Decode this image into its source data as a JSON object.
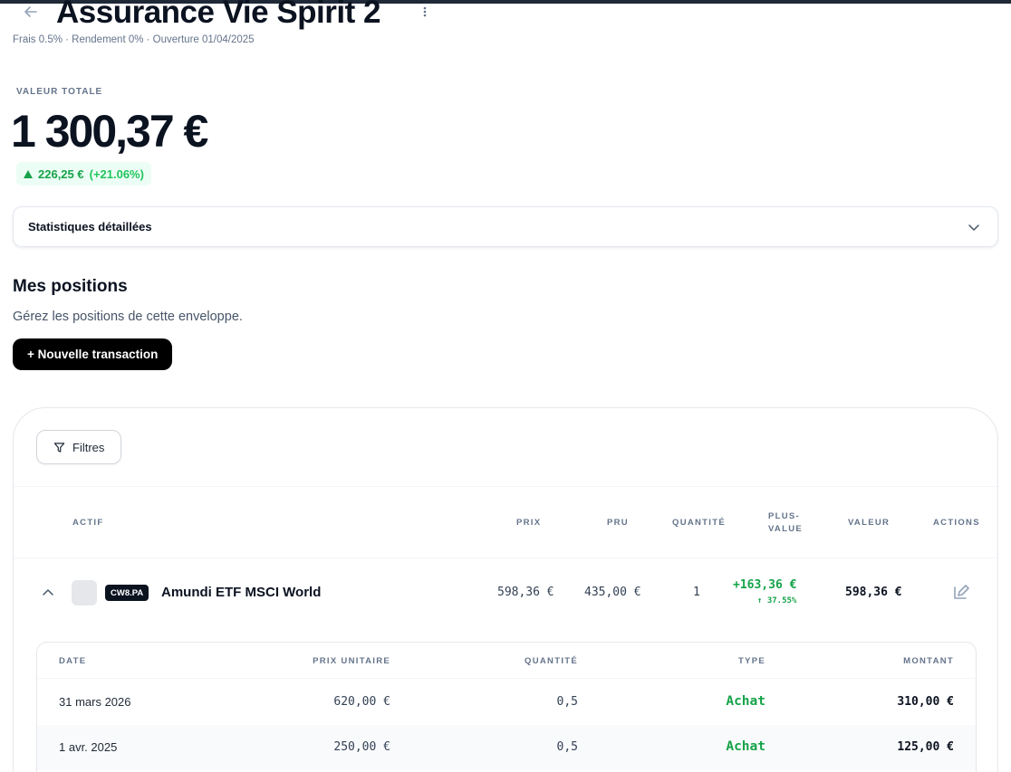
{
  "header": {
    "title": "Assurance Vie Spirit 2",
    "subtitle": "Frais 0.5% · Rendement 0% · Ouverture 01/04/2025"
  },
  "summary": {
    "label": "VALEUR TOTALE",
    "value": "1 300,37 €",
    "gain_amount": "226,25 €",
    "gain_percent": "(+21.06%)"
  },
  "stats": {
    "label": "Statistiques détaillées"
  },
  "positions": {
    "title": "Mes positions",
    "subtitle": "Gérez les positions de cette enveloppe.",
    "new_button": "+ Nouvelle transaction",
    "filters_label": "Filtres",
    "columns": {
      "actif": "ACTIF",
      "prix": "PRIX",
      "pru": "PRU",
      "quantite": "QUANTITÉ",
      "plus_value_1": "PLUS-",
      "plus_value_2": "VALUE",
      "valeur": "VALEUR",
      "actions": "ACTIONS"
    },
    "rows": [
      {
        "ticker": "CW8.PA",
        "name": "Amundi ETF MSCI World",
        "prix": "598,36 €",
        "pru": "435,00 €",
        "quantite": "1",
        "plus_value": "+163,36 €",
        "plus_value_pct": "↑ 37.55%",
        "valeur": "598,36 €"
      }
    ]
  },
  "transactions": {
    "columns": {
      "date": "DATE",
      "prix_unitaire": "PRIX UNITAIRE",
      "quantite": "QUANTITÉ",
      "type": "TYPE",
      "montant": "MONTANT"
    },
    "rows": [
      {
        "date": "31 mars 2026",
        "prix_unitaire": "620,00 €",
        "quantite": "0,5",
        "type": "Achat",
        "montant": "310,00 €"
      },
      {
        "date": "1 avr. 2025",
        "prix_unitaire": "250,00 €",
        "quantite": "0,5",
        "type": "Achat",
        "montant": "125,00 €"
      }
    ]
  },
  "colors": {
    "gain": "#16a34a",
    "dark": "#0b1220",
    "muted": "#64748b"
  }
}
